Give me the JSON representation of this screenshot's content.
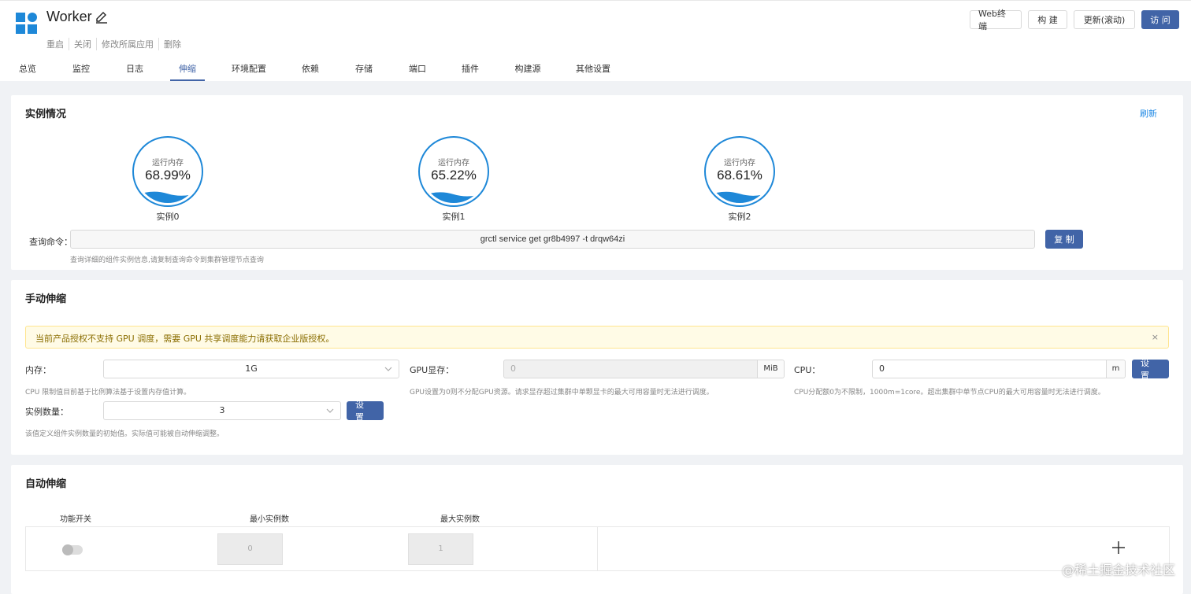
{
  "header": {
    "title": "Worker",
    "actions": [
      "重启",
      "关闭",
      "修改所属应用",
      "删除"
    ],
    "buttons": {
      "web_terminal": "Web终端",
      "build": "构 建",
      "update": "更新(滚动)",
      "visit": "访 问"
    }
  },
  "tabs": [
    "总览",
    "监控",
    "日志",
    "伸缩",
    "环境配置",
    "依赖",
    "存储",
    "端口",
    "插件",
    "构建源",
    "其他设置"
  ],
  "active_tab": "伸缩",
  "instances": {
    "title": "实例情况",
    "refresh": "刷新",
    "gauge_label": "运行内存",
    "items": [
      {
        "name": "实例0",
        "value": "68.99%",
        "level": 0.6899
      },
      {
        "name": "实例1",
        "value": "65.22%",
        "level": 0.6522
      },
      {
        "name": "实例2",
        "value": "68.61%",
        "level": 0.6861
      }
    ],
    "cmd_label": "查询命令：",
    "cmd_value": "grctl service get gr8b4997 -t drqw64zi",
    "copy_button": "复 制",
    "cmd_hint": "查询详细的组件实例信息,请复制查询命令到集群管理节点查询"
  },
  "manual": {
    "title": "手动伸缩",
    "alert": "当前产品授权不支持 GPU 调度，需要 GPU 共享调度能力请获取企业版授权。",
    "alert_close": "×",
    "memory_label": "内存：",
    "memory_value": "1G",
    "memory_hint": "CPU 限制值目前基于比例算法基于设置内存值计算。",
    "gpu_label": "GPU显存：",
    "gpu_value": "0",
    "gpu_unit": "MiB",
    "gpu_hint": "GPU设置为0则不分配GPU资源。请求显存超过集群中单颗显卡的最大可用容量时无法进行调度。",
    "cpu_label": "CPU：",
    "cpu_value": "0",
    "cpu_unit": "m",
    "cpu_button": "设 置",
    "cpu_hint": "CPU分配额0为不限制，1000m=1core。超出集群中单节点CPU的最大可用容量时无法进行调度。",
    "count_label": "实例数量：",
    "count_value": "3",
    "count_button": "设 置",
    "count_hint": "该值定义组件实例数量的初始值。实际值可能被自动伸缩调整。"
  },
  "autoscale": {
    "title": "自动伸缩",
    "col_switch": "功能开关",
    "col_min": "最小实例数",
    "col_max": "最大实例数",
    "min_value": "0",
    "max_value": "1",
    "switch_on": false
  },
  "watermark": "@稀土掘金技术社区",
  "colors": {
    "primary": "#4164a7",
    "gauge": "#1e88d8",
    "link": "#1e88e5"
  }
}
